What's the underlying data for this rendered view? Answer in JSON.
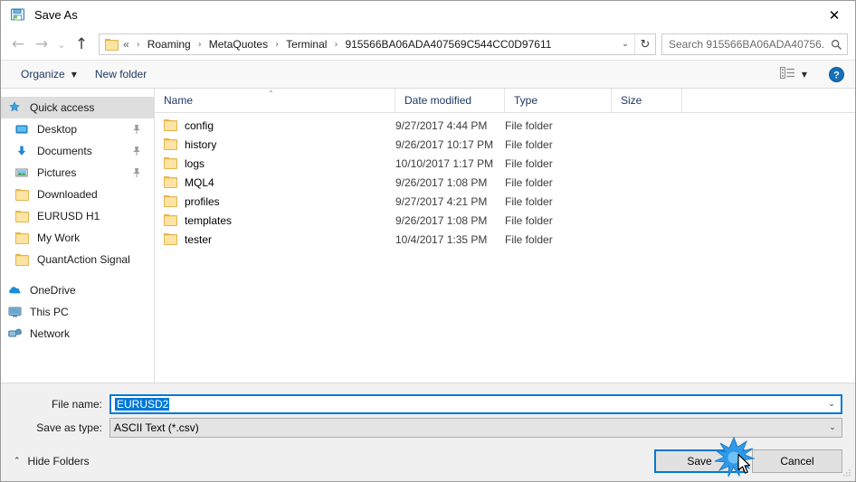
{
  "window": {
    "title": "Save As",
    "icon": "save-as-icon",
    "close_label": "✕"
  },
  "nav": {
    "back_icon": "←",
    "forward_icon": "→",
    "recent_icon": "⌄",
    "up_icon": "↑",
    "refresh_icon": "↻",
    "dropdown_icon": "⌄",
    "breadcrumb_prefix": "«",
    "crumbs": [
      "Roaming",
      "MetaQuotes",
      "Terminal",
      "915566BA06ADA407569C544CC0D97611"
    ],
    "separator": "›"
  },
  "search": {
    "placeholder": "Search 915566BA06ADA40756...",
    "icon": "search-icon"
  },
  "toolbar": {
    "organize_label": "Organize",
    "organize_caret": "▼",
    "new_folder_label": "New folder",
    "view_icon": "view-layout-icon",
    "view_caret": "▼",
    "help_icon": "help-icon",
    "help_label": "?"
  },
  "sidebar": {
    "items": [
      {
        "label": "Quick access",
        "icon": "star-icon",
        "selected": true,
        "pinned": false,
        "root": true
      },
      {
        "label": "Desktop",
        "icon": "desktop-icon",
        "selected": false,
        "pinned": true,
        "root": false
      },
      {
        "label": "Documents",
        "icon": "documents-download-icon",
        "selected": false,
        "pinned": true,
        "root": false
      },
      {
        "label": "Pictures",
        "icon": "pictures-icon",
        "selected": false,
        "pinned": true,
        "root": false
      },
      {
        "label": "Downloaded",
        "icon": "folder-icon",
        "selected": false,
        "pinned": false,
        "root": false
      },
      {
        "label": "EURUSD H1",
        "icon": "folder-icon",
        "selected": false,
        "pinned": false,
        "root": false
      },
      {
        "label": "My Work",
        "icon": "folder-icon",
        "selected": false,
        "pinned": false,
        "root": false
      },
      {
        "label": "QuantAction Signal",
        "icon": "folder-icon",
        "selected": false,
        "pinned": false,
        "root": false
      }
    ],
    "roots": [
      {
        "label": "OneDrive",
        "icon": "onedrive-icon"
      },
      {
        "label": "This PC",
        "icon": "this-pc-icon"
      },
      {
        "label": "Network",
        "icon": "network-icon"
      }
    ]
  },
  "filelist": {
    "columns": [
      "Name",
      "Date modified",
      "Type",
      "Size"
    ],
    "sort_caret": "⌃",
    "rows": [
      {
        "name": "config",
        "date": "9/27/2017 4:44 PM",
        "type": "File folder",
        "size": ""
      },
      {
        "name": "history",
        "date": "9/26/2017 10:17 PM",
        "type": "File folder",
        "size": ""
      },
      {
        "name": "logs",
        "date": "10/10/2017 1:17 PM",
        "type": "File folder",
        "size": ""
      },
      {
        "name": "MQL4",
        "date": "9/26/2017 1:08 PM",
        "type": "File folder",
        "size": ""
      },
      {
        "name": "profiles",
        "date": "9/27/2017 4:21 PM",
        "type": "File folder",
        "size": ""
      },
      {
        "name": "templates",
        "date": "9/26/2017 1:08 PM",
        "type": "File folder",
        "size": ""
      },
      {
        "name": "tester",
        "date": "10/4/2017 1:35 PM",
        "type": "File folder",
        "size": ""
      }
    ]
  },
  "form": {
    "filename_label": "File name:",
    "filename_value": "EURUSD2",
    "filetype_label": "Save as type:",
    "filetype_value": "ASCII Text (*.csv)",
    "dropdown_icon": "⌄"
  },
  "footer": {
    "hide_folders_label": "Hide Folders",
    "hide_folders_caret": "⌃",
    "save_label": "Save",
    "cancel_label": "Cancel"
  },
  "colors": {
    "accent": "#0078d7",
    "folder": "#fcd77f",
    "header_text": "#1f3864",
    "selection": "#dedede",
    "form_bg": "#f0f0f0"
  }
}
